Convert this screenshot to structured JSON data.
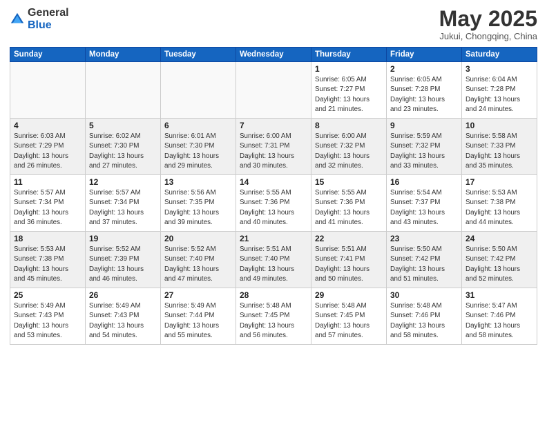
{
  "header": {
    "logo_general": "General",
    "logo_blue": "Blue",
    "month_title": "May 2025",
    "subtitle": "Jukui, Chongqing, China"
  },
  "weekdays": [
    "Sunday",
    "Monday",
    "Tuesday",
    "Wednesday",
    "Thursday",
    "Friday",
    "Saturday"
  ],
  "weeks": [
    [
      {
        "day": "",
        "info": ""
      },
      {
        "day": "",
        "info": ""
      },
      {
        "day": "",
        "info": ""
      },
      {
        "day": "",
        "info": ""
      },
      {
        "day": "1",
        "info": "Sunrise: 6:05 AM\nSunset: 7:27 PM\nDaylight: 13 hours\nand 21 minutes."
      },
      {
        "day": "2",
        "info": "Sunrise: 6:05 AM\nSunset: 7:28 PM\nDaylight: 13 hours\nand 23 minutes."
      },
      {
        "day": "3",
        "info": "Sunrise: 6:04 AM\nSunset: 7:28 PM\nDaylight: 13 hours\nand 24 minutes."
      }
    ],
    [
      {
        "day": "4",
        "info": "Sunrise: 6:03 AM\nSunset: 7:29 PM\nDaylight: 13 hours\nand 26 minutes."
      },
      {
        "day": "5",
        "info": "Sunrise: 6:02 AM\nSunset: 7:30 PM\nDaylight: 13 hours\nand 27 minutes."
      },
      {
        "day": "6",
        "info": "Sunrise: 6:01 AM\nSunset: 7:30 PM\nDaylight: 13 hours\nand 29 minutes."
      },
      {
        "day": "7",
        "info": "Sunrise: 6:00 AM\nSunset: 7:31 PM\nDaylight: 13 hours\nand 30 minutes."
      },
      {
        "day": "8",
        "info": "Sunrise: 6:00 AM\nSunset: 7:32 PM\nDaylight: 13 hours\nand 32 minutes."
      },
      {
        "day": "9",
        "info": "Sunrise: 5:59 AM\nSunset: 7:32 PM\nDaylight: 13 hours\nand 33 minutes."
      },
      {
        "day": "10",
        "info": "Sunrise: 5:58 AM\nSunset: 7:33 PM\nDaylight: 13 hours\nand 35 minutes."
      }
    ],
    [
      {
        "day": "11",
        "info": "Sunrise: 5:57 AM\nSunset: 7:34 PM\nDaylight: 13 hours\nand 36 minutes."
      },
      {
        "day": "12",
        "info": "Sunrise: 5:57 AM\nSunset: 7:34 PM\nDaylight: 13 hours\nand 37 minutes."
      },
      {
        "day": "13",
        "info": "Sunrise: 5:56 AM\nSunset: 7:35 PM\nDaylight: 13 hours\nand 39 minutes."
      },
      {
        "day": "14",
        "info": "Sunrise: 5:55 AM\nSunset: 7:36 PM\nDaylight: 13 hours\nand 40 minutes."
      },
      {
        "day": "15",
        "info": "Sunrise: 5:55 AM\nSunset: 7:36 PM\nDaylight: 13 hours\nand 41 minutes."
      },
      {
        "day": "16",
        "info": "Sunrise: 5:54 AM\nSunset: 7:37 PM\nDaylight: 13 hours\nand 43 minutes."
      },
      {
        "day": "17",
        "info": "Sunrise: 5:53 AM\nSunset: 7:38 PM\nDaylight: 13 hours\nand 44 minutes."
      }
    ],
    [
      {
        "day": "18",
        "info": "Sunrise: 5:53 AM\nSunset: 7:38 PM\nDaylight: 13 hours\nand 45 minutes."
      },
      {
        "day": "19",
        "info": "Sunrise: 5:52 AM\nSunset: 7:39 PM\nDaylight: 13 hours\nand 46 minutes."
      },
      {
        "day": "20",
        "info": "Sunrise: 5:52 AM\nSunset: 7:40 PM\nDaylight: 13 hours\nand 47 minutes."
      },
      {
        "day": "21",
        "info": "Sunrise: 5:51 AM\nSunset: 7:40 PM\nDaylight: 13 hours\nand 49 minutes."
      },
      {
        "day": "22",
        "info": "Sunrise: 5:51 AM\nSunset: 7:41 PM\nDaylight: 13 hours\nand 50 minutes."
      },
      {
        "day": "23",
        "info": "Sunrise: 5:50 AM\nSunset: 7:42 PM\nDaylight: 13 hours\nand 51 minutes."
      },
      {
        "day": "24",
        "info": "Sunrise: 5:50 AM\nSunset: 7:42 PM\nDaylight: 13 hours\nand 52 minutes."
      }
    ],
    [
      {
        "day": "25",
        "info": "Sunrise: 5:49 AM\nSunset: 7:43 PM\nDaylight: 13 hours\nand 53 minutes."
      },
      {
        "day": "26",
        "info": "Sunrise: 5:49 AM\nSunset: 7:43 PM\nDaylight: 13 hours\nand 54 minutes."
      },
      {
        "day": "27",
        "info": "Sunrise: 5:49 AM\nSunset: 7:44 PM\nDaylight: 13 hours\nand 55 minutes."
      },
      {
        "day": "28",
        "info": "Sunrise: 5:48 AM\nSunset: 7:45 PM\nDaylight: 13 hours\nand 56 minutes."
      },
      {
        "day": "29",
        "info": "Sunrise: 5:48 AM\nSunset: 7:45 PM\nDaylight: 13 hours\nand 57 minutes."
      },
      {
        "day": "30",
        "info": "Sunrise: 5:48 AM\nSunset: 7:46 PM\nDaylight: 13 hours\nand 58 minutes."
      },
      {
        "day": "31",
        "info": "Sunrise: 5:47 AM\nSunset: 7:46 PM\nDaylight: 13 hours\nand 58 minutes."
      }
    ]
  ]
}
